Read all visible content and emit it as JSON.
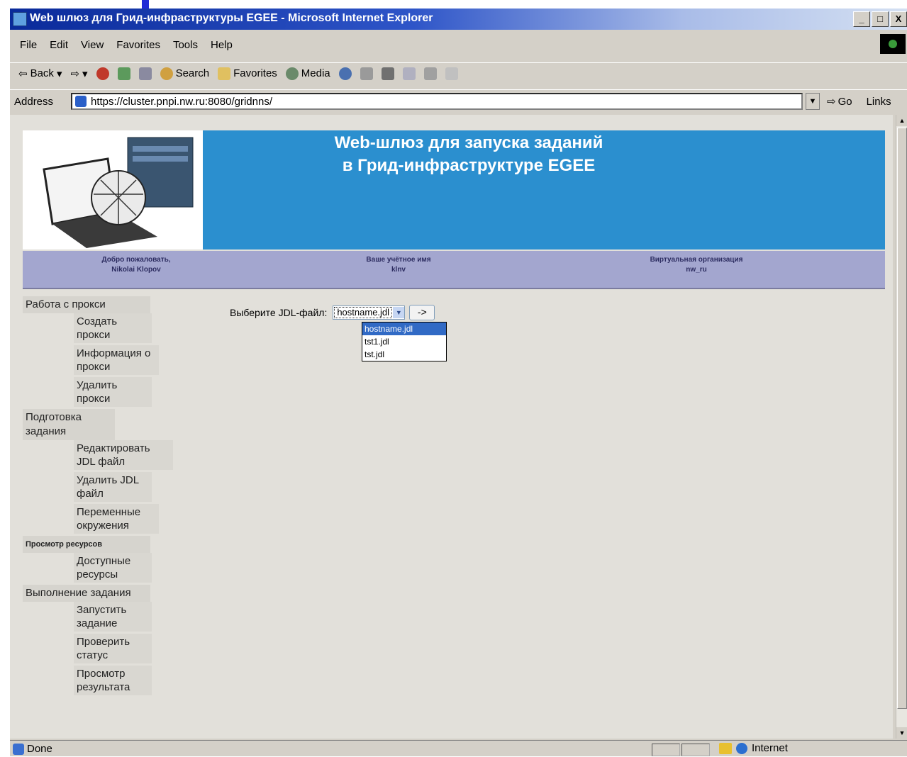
{
  "window": {
    "title": "Web шлюз для Грид-инфраструктуры EGEE - Microsoft Internet Explorer",
    "buttons": [
      "_",
      "□",
      "X"
    ]
  },
  "menu": [
    "File",
    "Edit",
    "View",
    "Favorites",
    "Tools",
    "Help"
  ],
  "toolbar": {
    "back": "Back",
    "search": "Search",
    "favorites": "Favorites",
    "media": "Media"
  },
  "address": {
    "label": "Address",
    "url": "https://cluster.pnpi.nw.ru:8080/gridnns/",
    "go": "Go",
    "links": "Links"
  },
  "banner": {
    "title_line1": "Web-шлюз для запуска заданий",
    "title_line2": "в Грид-инфраструктуре EGEE"
  },
  "infobar": {
    "welcome_label": "Добро пожаловать,",
    "welcome_name": "Nikolai Klopov",
    "account_label": "Ваше учётное имя",
    "account_value": "klnv",
    "vo_label": "Виртуальная организация",
    "vo_value": "nw_ru"
  },
  "nav": {
    "proxy": {
      "title": "Работа с прокси",
      "items": [
        "Создать прокси",
        "Информация о прокси",
        "Удалить прокси"
      ]
    },
    "prep": {
      "title": "Подготовка задания",
      "items": [
        "Редактировать JDL файл",
        "Удалить JDL файл",
        "Переменные окружения"
      ]
    },
    "resources": {
      "title": "Просмотр ресурсов",
      "items": [
        "Доступные ресурсы"
      ]
    },
    "run": {
      "title": "Выполнение задания",
      "items": [
        "Запустить задание",
        "Проверить статус",
        "Просмотр результата"
      ]
    }
  },
  "jdl": {
    "label": "Выберите JDL-файл:",
    "selected": "hostname.jdl",
    "options": [
      "hostname.jdl",
      "tst1.jdl",
      "tst.jdl"
    ],
    "go": "->"
  },
  "status": {
    "text": "Done",
    "zone": "Internet"
  }
}
